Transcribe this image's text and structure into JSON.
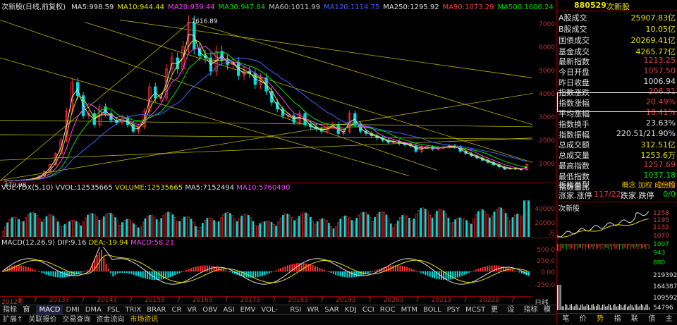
{
  "header": {
    "title": "次新股(日线,前复权)",
    "ma": [
      {
        "label": "MA5:",
        "value": "998.59",
        "color": "#e0e0e0"
      },
      {
        "label": "MA10:",
        "value": "944.44",
        "color": "#e8e000"
      },
      {
        "label": "MA20:",
        "value": "939.44",
        "color": "#ff40ff"
      },
      {
        "label": "MA30:",
        "value": "947.84",
        "color": "#00e000"
      },
      {
        "label": "MA60:",
        "value": "1011.99",
        "color": "#c8c8c8"
      },
      {
        "label": "MA120:",
        "value": "1114.75",
        "color": "#4060ff"
      },
      {
        "label": "MA250:",
        "value": "1295.92",
        "color": "#e0e0e0"
      },
      {
        "label": "MA90:",
        "value": "1073.29",
        "color": "#ff4040"
      },
      {
        "label": "MA500:",
        "value": "1606.24",
        "color": "#00e000"
      }
    ],
    "annot_high": "7616.89",
    "annot_low": "479.98",
    "y_labels": [
      "7000",
      "6000",
      "5000",
      "4000",
      "3000",
      "2000",
      "1000"
    ]
  },
  "volume": {
    "title": "VOL-TDX(5,10)",
    "vvol_label": "VVOL:",
    "vvol_value": "12535665",
    "volume_label": "VOLUME:",
    "volume_value": "12535665",
    "ma5_label": "MA5:",
    "ma5_value": "7152494",
    "ma10_label": "MA10:",
    "ma10_value": "5760490",
    "y_labels": [
      "40000",
      "20000",
      "万"
    ]
  },
  "macd": {
    "title": "MACD(12,26,9)",
    "dif_label": "DIF:",
    "dif_value": "9.16",
    "dea_label": "DEA:",
    "dea_value": "-19.94",
    "macd_label": "MACD:",
    "macd_value": "58.21",
    "y_labels": [
      "500.0",
      "250.0",
      "0.00",
      "-250.0"
    ]
  },
  "xaxis": {
    "labels": [
      "2012年",
      "3",
      "7",
      "2013",
      "3",
      "7",
      "2014",
      "3",
      "7",
      "2015",
      "3",
      "7",
      "2016",
      "3",
      "7",
      "2017",
      "3",
      "7",
      "2018",
      "3",
      "7",
      "2019",
      "3",
      "7",
      "2020",
      "3",
      "7",
      "2021",
      "3",
      "7",
      "2022",
      "3",
      "7"
    ]
  },
  "indicator_tabs": [
    "指标A",
    "窗口",
    "MACD",
    "DMI",
    "DMA",
    "FSL",
    "TRIX",
    "BRAR",
    "CR",
    "VR",
    "OBV",
    "ASI",
    "EMV",
    "VOL-TDX",
    "RSI",
    "WR",
    "SAR",
    "KDJ",
    "CCI",
    "ROC",
    "MTM",
    "BOLL",
    "PSY",
    "MCST",
    "更多",
    "设置"
  ],
  "indicator_active": "MACD",
  "right_tabs_bottom_left": [
    "指标B",
    "模板"
  ],
  "side_label": "日线",
  "bottom_tabs": [
    "扩展↑",
    "关联报价",
    "交易查询",
    "资金流向",
    "市场资讯"
  ],
  "bottom_active": "市场资讯",
  "right": {
    "code": "880529",
    "name": "次新股",
    "rows": [
      {
        "label": "A股成交",
        "value": "25907.83亿",
        "cls": "y"
      },
      {
        "label": "B股成交",
        "value": "10.05亿",
        "cls": "y"
      },
      {
        "label": "国债成交",
        "value": "20269.41亿",
        "cls": "y"
      },
      {
        "label": "基金成交",
        "value": "4265.77亿",
        "cls": "y"
      },
      {
        "label": "最新指数",
        "value": "1213.25",
        "cls": "r"
      },
      {
        "label": "今日开盘",
        "value": "1057.50",
        "cls": "r"
      },
      {
        "label": "昨日收盘",
        "value": "1006.94",
        "cls": "w"
      },
      {
        "label": "指数涨跌",
        "value": "206.31",
        "cls": "r"
      },
      {
        "label": "指数涨幅",
        "value": "20.49%",
        "cls": "r"
      },
      {
        "label": "平均涨幅",
        "value": "18.41%",
        "cls": "r"
      },
      {
        "label": "指数换手",
        "value": "23.63%",
        "cls": "w"
      },
      {
        "label": "指数振幅",
        "value": "220.51/21.90%",
        "cls": "w"
      },
      {
        "label": "总成交额",
        "value": "312.51亿",
        "cls": "y"
      },
      {
        "label": "总成交量",
        "value": "1253.6万",
        "cls": "y"
      },
      {
        "label": "最高指数",
        "value": "1257.69",
        "cls": "r"
      },
      {
        "label": "最低指数",
        "value": "1037.18",
        "cls": "g"
      },
      {
        "label": "指数量比",
        "value": "2.33",
        "cls": "r"
      }
    ],
    "board_type_label": "板指类型",
    "board_types": [
      "概念",
      "加权",
      "成份股"
    ],
    "up_label": "涨家.涨停",
    "up_value": "117/22",
    "down_label": "跌家.跌停",
    "down_value": "0/0",
    "mini_title": "次新股",
    "mini_y": [
      "1258",
      "1195",
      "1132",
      "1070",
      "1007",
      "943",
      "880",
      "219392",
      "164387",
      "109592",
      "54796"
    ],
    "bottom_tabs": [
      "笔",
      "价",
      "势",
      "指",
      "联",
      "值",
      "主"
    ],
    "bottom_active": "势"
  },
  "kline_closes": [
    480,
    490,
    500,
    520,
    540,
    600,
    700,
    900,
    1200,
    1700,
    2300,
    3600,
    4900,
    4300,
    3400,
    3500,
    3000,
    3800,
    3500,
    3200,
    3100,
    3300,
    3000,
    2700,
    2900,
    3600,
    4700,
    4200,
    4200,
    5500,
    6000,
    5500,
    6500,
    7600,
    6400,
    6100,
    6000,
    5400,
    6300,
    5900,
    5700,
    5800,
    5200,
    5400,
    5300,
    4800,
    5100,
    4500,
    4000,
    3700,
    3400,
    3400,
    3100,
    3500,
    3000,
    2900,
    2800,
    2700,
    2900,
    3000,
    2600,
    2700,
    3500,
    3000,
    2700,
    2600,
    2500,
    2400,
    2300,
    2200,
    2250,
    2150,
    2100,
    2050,
    1800,
    2000,
    2000,
    1900,
    1950,
    2000,
    2050,
    2000,
    1800,
    1700,
    1600,
    1500,
    1400,
    1300,
    1200,
    1100,
    1000,
    1050,
    1000,
    980,
    1213
  ],
  "colors": {
    "up": "#ff3030",
    "down": "#00e0e0",
    "ma5": "#e0e0e0",
    "ma10": "#e8e000",
    "ma20": "#ff40ff",
    "ma30": "#00e000",
    "grid": "#8b0000",
    "trend": "#e8e000"
  }
}
